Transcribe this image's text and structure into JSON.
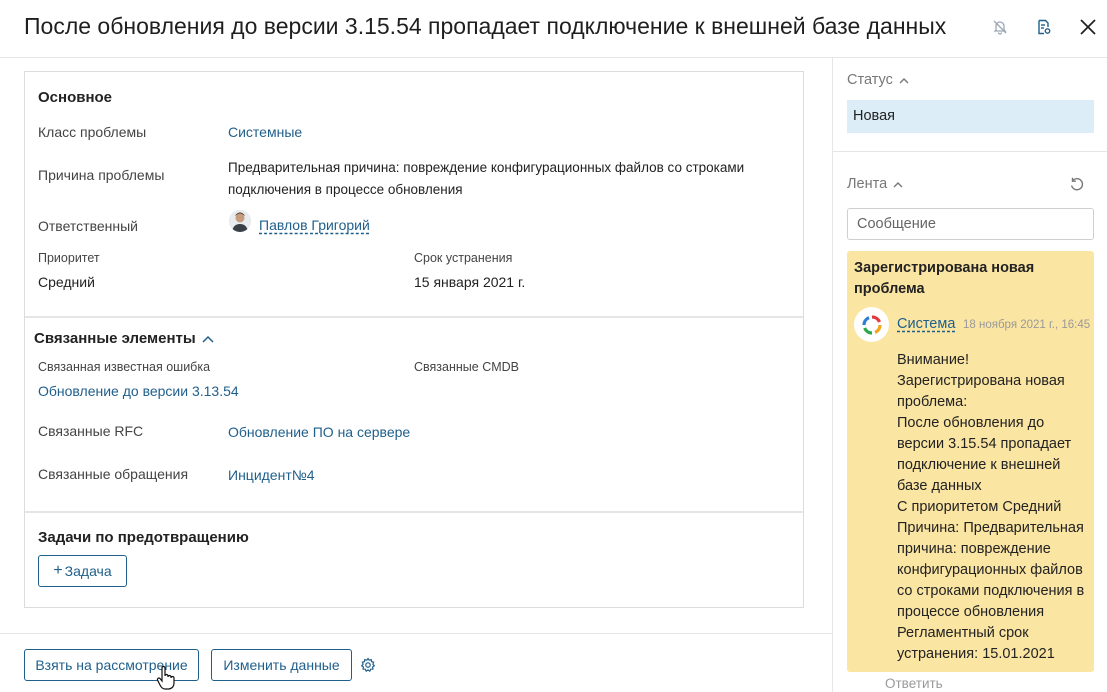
{
  "header": {
    "title": "После обновления до версии 3.15.54 пропадает подключение к внешней базе данных",
    "icons": [
      "bell-off-icon",
      "document-settings-icon",
      "close-icon"
    ]
  },
  "main": {
    "basic": {
      "heading": "Основное",
      "problem_class_label": "Класс проблемы",
      "problem_class_value": "Системные",
      "cause_label": "Причина проблемы",
      "cause_value": "Предварительная причина: повреждение конфигурационных файлов со строками подключения в процессе обновления",
      "responsible_label": "Ответственный",
      "responsible_value": "Павлов Григорий",
      "priority_label": "Приоритет",
      "priority_value": "Средний",
      "deadline_label": "Срок устранения",
      "deadline_value": "15 января 2021 г."
    },
    "related": {
      "heading": "Связанные элементы",
      "known_error_label": "Связанная известная ошибка",
      "known_error_value": "Обновление до версии 3.13.54",
      "cmdb_label": "Связанные CMDB",
      "rfc_label": "Связанные RFC",
      "rfc_value": "Обновление ПО на сервере",
      "requests_label": "Связанные обращения",
      "requests_value": "Инцидент№4"
    },
    "tasks": {
      "heading": "Задачи по предотвращению",
      "add_task_label": "Задача"
    }
  },
  "footer": {
    "take_button": "Взять на рассмотрение",
    "edit_button": "Изменить данные"
  },
  "sidebar": {
    "status_label": "Статус",
    "status_value": "Новая",
    "feed_label": "Лента",
    "message_placeholder": "Сообщение",
    "feed_item": {
      "title": "Зарегистрирована новая проблема",
      "author": "Система",
      "date": "18 ноября 2021 г., 16:45",
      "body_lines": [
        "Внимание!",
        "Зарегистрирована новая",
        "проблема:",
        "После обновления до",
        "версии 3.15.54 пропадает",
        "подключение к внешней",
        "базе данных",
        "С приоритетом Средний",
        "Причина: Предварительная",
        "причина: повреждение",
        "конфигурационных файлов",
        "со строками подключения в",
        "процессе обновления",
        "Регламентный срок",
        "устранения: 15.01.2021"
      ]
    },
    "reply_label": "Ответить"
  },
  "colors": {
    "accent": "#1f5f8b",
    "status_bg": "#dcedf7",
    "feed_bg": "#fbe5a2"
  }
}
